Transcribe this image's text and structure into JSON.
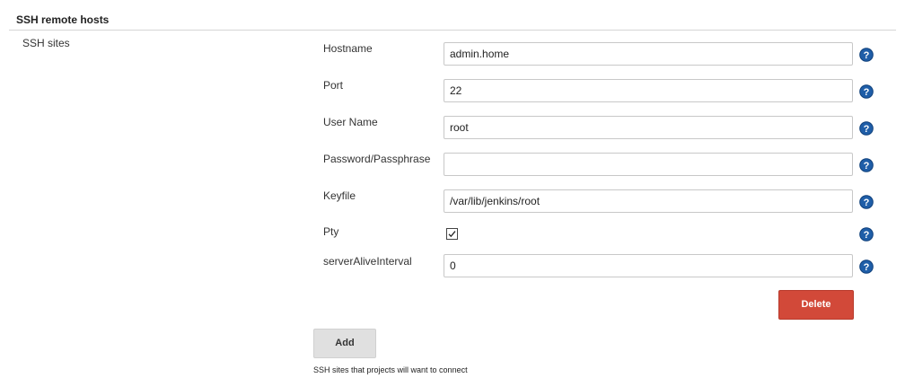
{
  "section": {
    "title": "SSH remote hosts"
  },
  "group": {
    "label": "SSH sites"
  },
  "fields": {
    "hostname": {
      "label": "Hostname",
      "value": "admin.home"
    },
    "port": {
      "label": "Port",
      "value": "22"
    },
    "username": {
      "label": "User Name",
      "value": "root"
    },
    "password": {
      "label": "Password/Passphrase",
      "value": ""
    },
    "keyfile": {
      "label": "Keyfile",
      "value": "/var/lib/jenkins/root"
    },
    "pty": {
      "label": "Pty",
      "checked": true
    },
    "serverAliveInterval": {
      "label": "serverAliveInterval",
      "value": "0"
    }
  },
  "buttons": {
    "delete_label": "Delete",
    "add_label": "Add"
  },
  "description": "SSH sites that projects will want to connect",
  "colors": {
    "delete": "#d24939",
    "help_icon": "#1f5ea8"
  },
  "icons": {
    "help": "help-icon",
    "checkmark": "checkmark-icon"
  }
}
